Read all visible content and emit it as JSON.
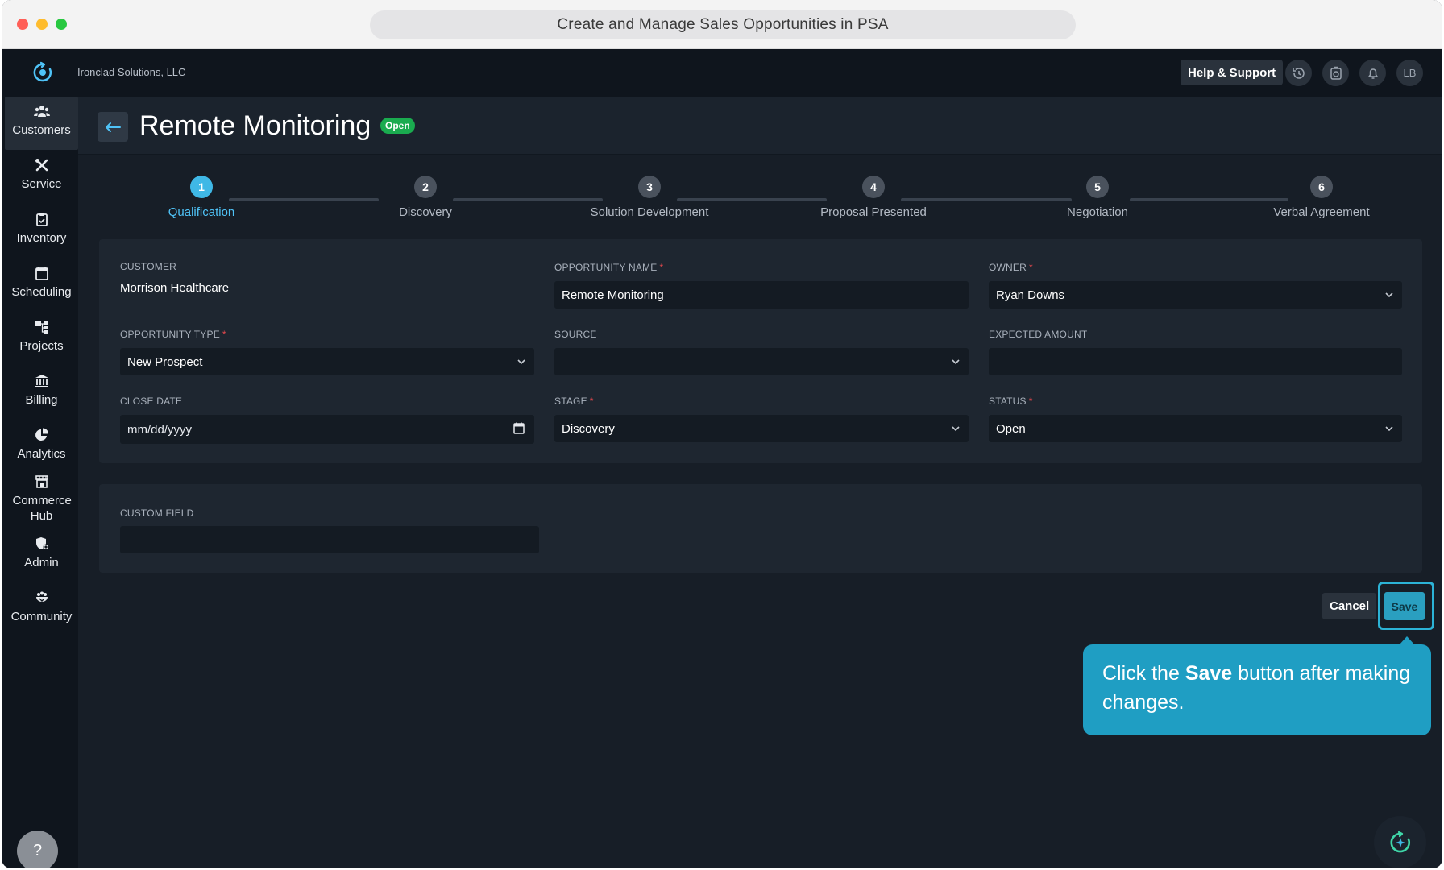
{
  "browser": {
    "url_title": "Create and Manage Sales Opportunities in PSA"
  },
  "header": {
    "company": "Ironclad Solutions, LLC",
    "help_label": "Help & Support",
    "avatar_initials": "LB"
  },
  "sidebar": {
    "items": [
      {
        "label": "Customers",
        "icon": "users-icon"
      },
      {
        "label": "Service",
        "icon": "tools-icon"
      },
      {
        "label": "Inventory",
        "icon": "clipboard-icon"
      },
      {
        "label": "Scheduling",
        "icon": "calendar-icon"
      },
      {
        "label": "Projects",
        "icon": "hierarchy-icon"
      },
      {
        "label": "Billing",
        "icon": "bank-icon"
      },
      {
        "label": "Analytics",
        "icon": "pie-chart-icon"
      },
      {
        "label": "Commerce Hub",
        "icon": "store-icon"
      },
      {
        "label": "Admin",
        "icon": "shield-icon"
      },
      {
        "label": "Community",
        "icon": "community-icon"
      }
    ],
    "help_glyph": "?"
  },
  "page": {
    "title": "Remote Monitoring",
    "status_badge": "Open"
  },
  "stepper": {
    "steps": [
      {
        "number": "1",
        "label": "Qualification"
      },
      {
        "number": "2",
        "label": "Discovery"
      },
      {
        "number": "3",
        "label": "Solution Development"
      },
      {
        "number": "4",
        "label": "Proposal Presented"
      },
      {
        "number": "5",
        "label": "Negotiation"
      },
      {
        "number": "6",
        "label": "Verbal Agreement"
      }
    ],
    "active_step": 1
  },
  "form": {
    "customer": {
      "label": "CUSTOMER",
      "value": "Morrison Healthcare"
    },
    "opportunity_name": {
      "label": "OPPORTUNITY NAME",
      "value": "Remote Monitoring",
      "required": "*"
    },
    "owner": {
      "label": "OWNER",
      "value": "Ryan Downs",
      "required": "*"
    },
    "opportunity_type": {
      "label": "OPPORTUNITY TYPE",
      "value": "New Prospect",
      "required": "*"
    },
    "source": {
      "label": "SOURCE",
      "value": ""
    },
    "expected_amount": {
      "label": "EXPECTED AMOUNT",
      "value": ""
    },
    "close_date": {
      "label": "CLOSE DATE",
      "placeholder": "mm/dd/yyyy"
    },
    "stage": {
      "label": "STAGE",
      "value": "Discovery",
      "required": "*"
    },
    "status": {
      "label": "STATUS",
      "value": "Open",
      "required": "*"
    }
  },
  "custom": {
    "custom_field": {
      "label": "CUSTOM FIELD",
      "value": ""
    }
  },
  "actions": {
    "cancel_label": "Cancel",
    "save_label": "Save"
  },
  "tooltip": {
    "prefix": "Click the ",
    "bold": "Save",
    "suffix": " button after making changes."
  },
  "colors": {
    "accent": "#3fb8e6",
    "status_open": "#1aab4f",
    "tooltip_bg": "#1f9ec3",
    "required": "#e5484d"
  }
}
